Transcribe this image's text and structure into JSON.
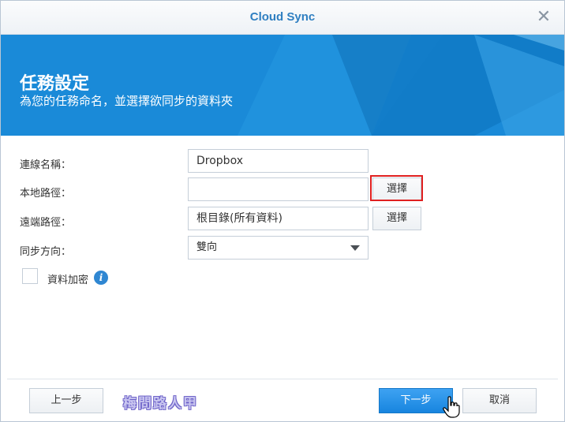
{
  "window": {
    "title": "Cloud Sync"
  },
  "banner": {
    "title": "任務設定",
    "subtitle": "為您的任務命名，並選擇欲同步的資料夾"
  },
  "form": {
    "connection_name": {
      "label": "連線名稱：",
      "value": "Dropbox"
    },
    "local_path": {
      "label": "本地路徑：",
      "value": "",
      "button": "選擇"
    },
    "remote_path": {
      "label": "遠端路徑：",
      "value": "根目錄(所有資料)",
      "button": "選擇"
    },
    "sync_direction": {
      "label": "同步方向：",
      "selected": "雙向"
    },
    "encryption": {
      "label": "資料加密",
      "checked": false
    }
  },
  "footer": {
    "back": "上一步",
    "next": "下一步",
    "cancel": "取消"
  },
  "watermark": "梅問路人甲",
  "colors": {
    "accent": "#1788d6",
    "title": "#2f7fc1",
    "highlight": "#e02020"
  }
}
